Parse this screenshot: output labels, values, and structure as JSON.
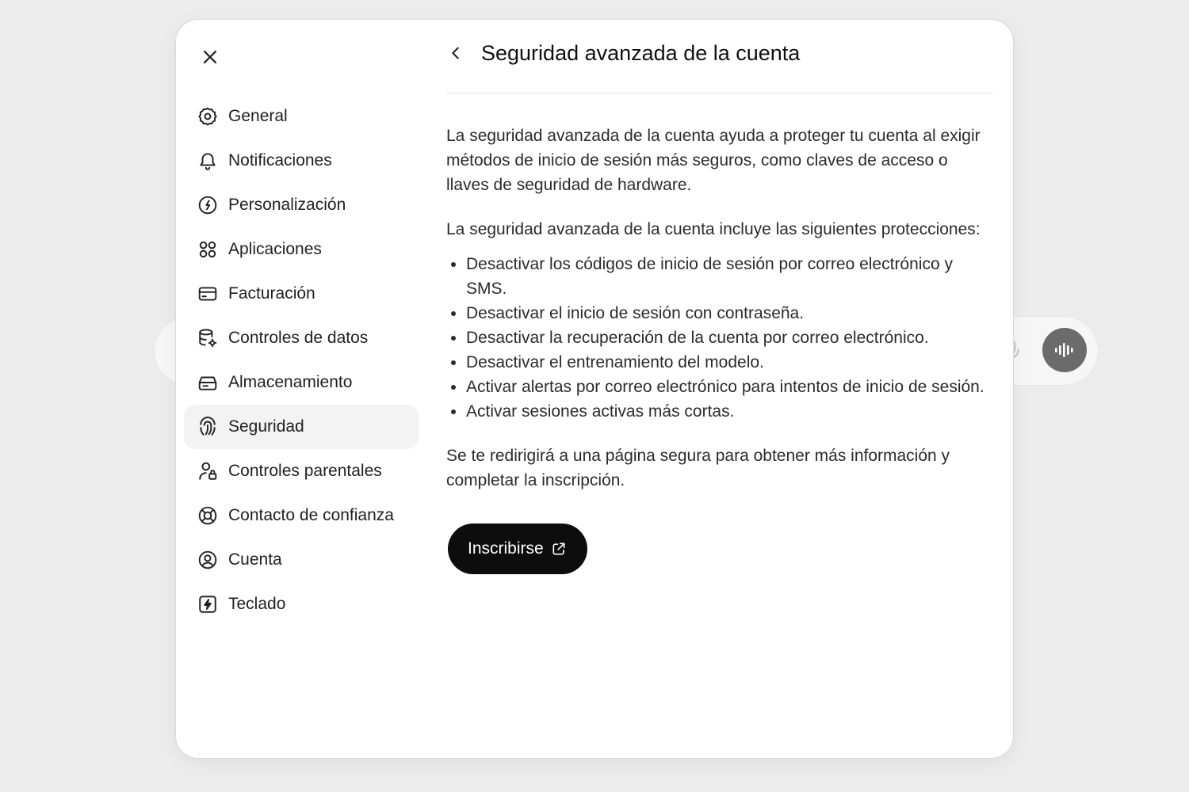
{
  "modal": {
    "close_icon": "close-icon",
    "back_icon": "chevron-left-icon",
    "title": "Seguridad avanzada de la cuenta"
  },
  "sidebar": {
    "items": [
      {
        "label": "General",
        "icon": "gear-icon",
        "active": false
      },
      {
        "label": "Notificaciones",
        "icon": "bell-icon",
        "active": false
      },
      {
        "label": "Personalización",
        "icon": "personalization-icon",
        "active": false
      },
      {
        "label": "Aplicaciones",
        "icon": "apps-grid-icon",
        "active": false
      },
      {
        "label": "Facturación",
        "icon": "credit-card-icon",
        "active": false
      },
      {
        "label": "Controles de datos",
        "icon": "database-gear-icon",
        "active": false
      },
      {
        "label": "Almacenamiento",
        "icon": "storage-drive-icon",
        "active": false
      },
      {
        "label": "Seguridad",
        "icon": "fingerprint-icon",
        "active": true
      },
      {
        "label": "Controles parentales",
        "icon": "parent-lock-icon",
        "active": false
      },
      {
        "label": "Contacto de confianza",
        "icon": "lifebuoy-icon",
        "active": false
      },
      {
        "label": "Cuenta",
        "icon": "user-circle-icon",
        "active": false
      },
      {
        "label": "Teclado",
        "icon": "keyboard-shortcut-icon",
        "active": false
      }
    ]
  },
  "content": {
    "intro": "La seguridad avanzada de la cuenta ayuda a proteger tu cuenta al exigir métodos de inicio de sesión más seguros, como claves de acceso o llaves de seguridad de hardware.",
    "includes": "La seguridad avanzada de la cuenta incluye las siguientes protecciones:",
    "protections": [
      "Desactivar los códigos de inicio de sesión por correo electrónico y SMS.",
      "Desactivar el inicio de sesión con contraseña.",
      "Desactivar la recuperación de la cuenta por correo electrónico.",
      "Desactivar el entrenamiento del modelo.",
      "Activar alertas por correo electrónico para intentos de inicio de sesión.",
      "Activar sesiones activas más cortas."
    ],
    "redirect": "Se te redirigirá a una página segura para obtener más información y completar la inscripción.",
    "enroll_label": "Inscribirse",
    "enroll_icon": "external-link-icon"
  },
  "colors": {
    "button_bg": "#0d0d0d",
    "active_item_bg": "#f3f3f3",
    "page_bg": "#ececec"
  }
}
